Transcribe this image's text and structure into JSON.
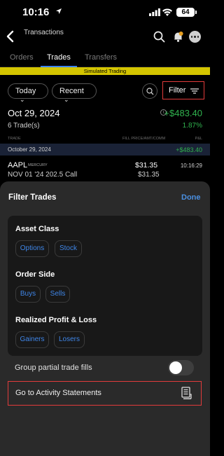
{
  "status_bar": {
    "time": "10:16",
    "battery": "64"
  },
  "nav": {
    "title": "Transactions"
  },
  "tabs": [
    {
      "label": "Orders"
    },
    {
      "label": "Trades"
    },
    {
      "label": "Transfers"
    }
  ],
  "banner": "Simulated Trading",
  "filters": {
    "period": "Today",
    "sort": "Recent",
    "filter_label": "Filter"
  },
  "summary": {
    "date": "Oct 29, 2024",
    "trades": "6 Trade(s)",
    "pl": "+$483.40",
    "pl_pct": "1.87%"
  },
  "columns": {
    "trade": "TRADE",
    "fill": "FILL PRICE/AMT/COMM",
    "pl": "P&L"
  },
  "day_row": {
    "date": "October 29, 2024",
    "pl": "+$483.40"
  },
  "trade": {
    "symbol": "AAPL",
    "exchange": "MERCURY",
    "description": "NOV 01 '24 202.5 Call",
    "price": "$31.35",
    "amount": "$31.35",
    "time": "10:16:29"
  },
  "sheet": {
    "title": "Filter Trades",
    "done": "Done",
    "asset_class": {
      "title": "Asset Class",
      "options": "Options",
      "stock": "Stock"
    },
    "order_side": {
      "title": "Order Side",
      "buys": "Buys",
      "sells": "Sells"
    },
    "realized": {
      "title": "Realized Profit & Loss",
      "gainers": "Gainers",
      "losers": "Losers"
    },
    "group_fills": "Group partial trade fills",
    "activity": "Go to Activity Statements"
  },
  "colors": {
    "accent": "#3b82f6",
    "gain": "#30b24e",
    "banner": "#d4c500",
    "highlight": "#e23b3b"
  }
}
